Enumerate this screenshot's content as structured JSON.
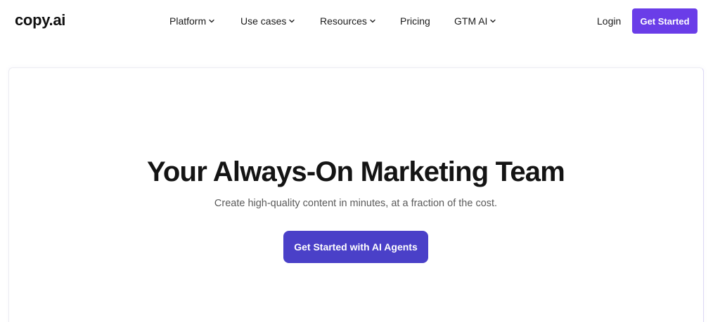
{
  "header": {
    "logo": "copy.ai",
    "nav": [
      {
        "label": "Platform",
        "has_dropdown": true
      },
      {
        "label": "Use cases",
        "has_dropdown": true
      },
      {
        "label": "Resources",
        "has_dropdown": true
      },
      {
        "label": "Pricing",
        "has_dropdown": false
      },
      {
        "label": "GTM AI",
        "has_dropdown": true
      }
    ],
    "login_label": "Login",
    "cta_label": "Get Started",
    "cta_color": "#6a3de8"
  },
  "hero": {
    "title": "Your Always-On Marketing Team",
    "subtitle": "Create high-quality content in minutes, at a fraction of the cost.",
    "cta_label": "Get Started with AI Agents",
    "cta_color": "#4a40c8"
  },
  "icons": {
    "dropdown": "chevron-down-icon"
  }
}
